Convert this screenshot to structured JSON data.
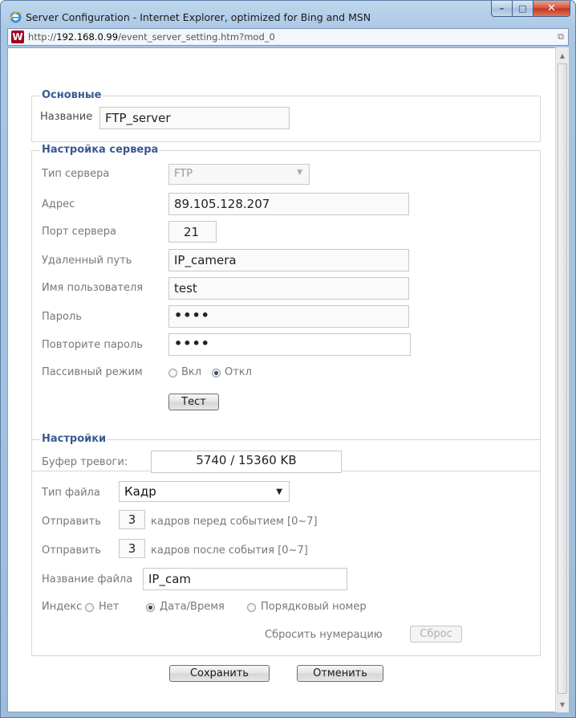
{
  "window": {
    "title": "Server Configuration - Internet Explorer, optimized for Bing and MSN",
    "url_prefix": "http://",
    "url_host": "192.168.0.99",
    "url_path": "/event_server_setting.htm?mod_0"
  },
  "basic": {
    "legend": "Основные",
    "name_label": "Название",
    "name_value": "FTP_server"
  },
  "server": {
    "legend": "Настройка сервера",
    "type_label": "Тип сервера",
    "type_value": "FTP",
    "address_label": "Адрес",
    "address_value": "89.105.128.207",
    "port_label": "Порт сервера",
    "port_value": "21",
    "path_label": "Удаленный путь",
    "path_value": "IP_camera",
    "user_label": "Имя пользователя",
    "user_value": "test",
    "password_label": "Пароль",
    "password_value": "••••",
    "repeat_label": "Повторите пароль",
    "repeat_value": "••••",
    "passive_label": "Пассивный режим",
    "passive_on": "Вкл",
    "passive_off": "Откл",
    "passive_selected": "Откл",
    "test_button": "Тест"
  },
  "settings": {
    "legend": "Настройки",
    "buffer_label": "Буфер тревоги:",
    "buffer_value": "5740 / 15360 KB",
    "filetype_label": "Тип файла",
    "filetype_value": "Кадр",
    "send_label": "Отправить",
    "before_value": "3",
    "before_text": "кадров перед событием [0~7]",
    "after_value": "3",
    "after_text": "кадров после события [0~7]",
    "filename_label": "Название файла",
    "filename_value": "IP_cam",
    "index_label": "Индекс",
    "index_none": "Нет",
    "index_datetime": "Дата/Время",
    "index_seq": "Порядковый номер",
    "index_selected": "Дата/Время",
    "reset_label": "Сбросить нумерацию",
    "reset_button": "Сброс"
  },
  "footer": {
    "save_button": "Сохранить",
    "cancel_button": "Отменить"
  }
}
